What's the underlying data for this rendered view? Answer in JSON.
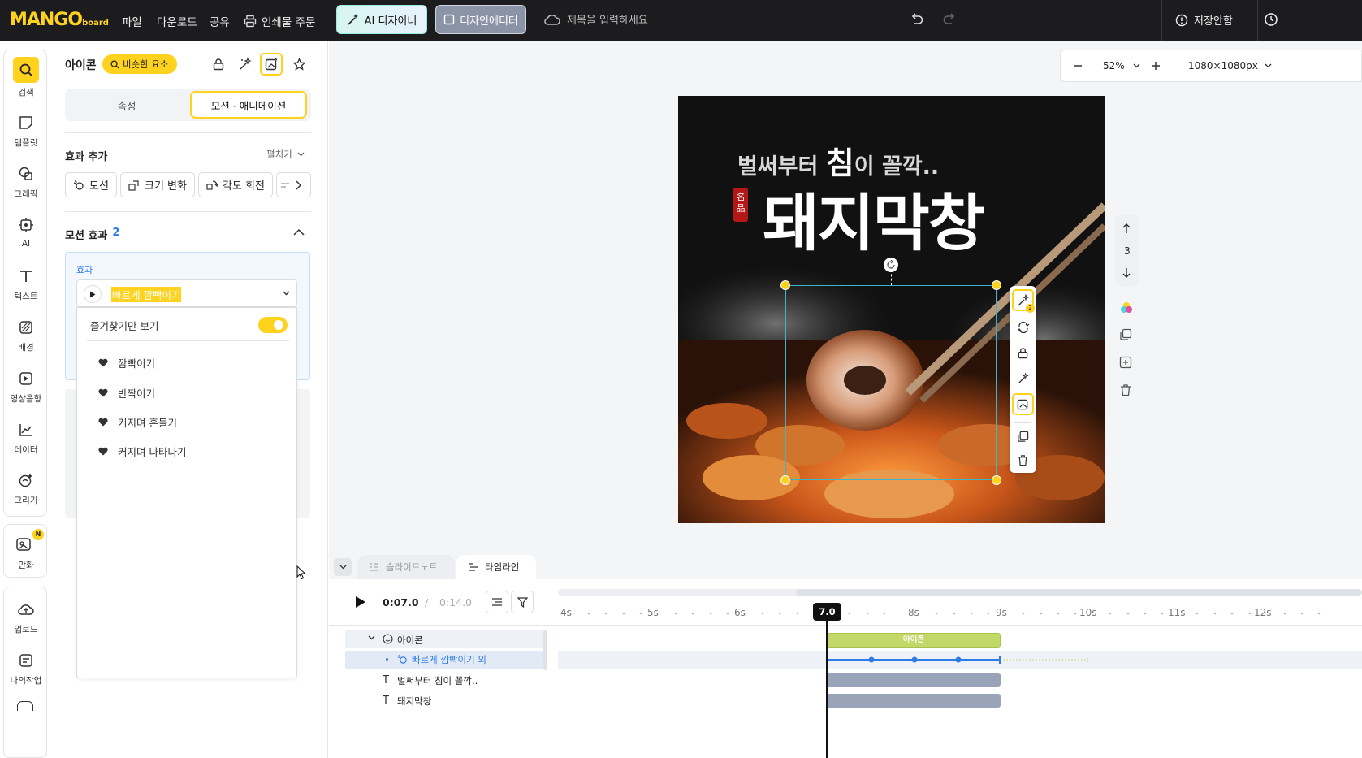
{
  "topbar": {
    "logo": "MANGO",
    "logo_sub": "board",
    "menu": [
      "파일",
      "다운로드",
      "공유",
      "인쇄물 주문"
    ],
    "ai_designer": "AI 디자이너",
    "design_editor": "디자인에디터",
    "title_placeholder": "제목을 입력하세요",
    "save_status": "저장안함"
  },
  "rail": {
    "items": [
      "검색",
      "템플릿",
      "그래픽",
      "AI",
      "텍스트",
      "배경",
      "영상음향",
      "데이터",
      "그리기"
    ],
    "comic": "만화",
    "comic_badge": "N",
    "bottom_items": [
      "업로드",
      "나의작업"
    ]
  },
  "panel": {
    "title": "아이콘",
    "similar_btn": "비슷한 요소",
    "tabs": [
      "속성",
      "모션 · 애니메이션"
    ],
    "add_effect": "효과 추가",
    "expand": "펼치기",
    "chips": [
      "모션",
      "크기 변화",
      "각도 회전"
    ],
    "motion_effects": "모션 효과",
    "motion_count": "2",
    "effect_label": "효과",
    "effect_value": "빠르게 깜빡이기",
    "favorites_only": "즐겨찾기만 보기",
    "dropdown_items": [
      "깜빡이기",
      "반짝이기",
      "커지며 흔들기",
      "커지며 나타나기"
    ]
  },
  "canvas": {
    "zoom": "52%",
    "size": "1080×1080px",
    "subtitle_pre": "벌써부터 ",
    "subtitle_big": "침",
    "subtitle_post": "이 꼴깍..",
    "headline": "돼지막창",
    "seal": "名品",
    "page_number": "3",
    "selection_badge": "2"
  },
  "timeline": {
    "tabs": [
      "슬라이드노트",
      "타임라인"
    ],
    "current_time": "0:07.0",
    "separator": "/",
    "total_time": "0:14.0",
    "ticks": [
      "4s",
      "5s",
      "6s",
      "8s",
      "9s",
      "10s",
      "11s",
      "12s"
    ],
    "playhead": "7.0",
    "layers": [
      "아이콘",
      "빠르게 깜빡이기 외",
      "벌써부터 침이 꼴깍..",
      "돼지막창"
    ],
    "bar_label": "아이콘"
  }
}
